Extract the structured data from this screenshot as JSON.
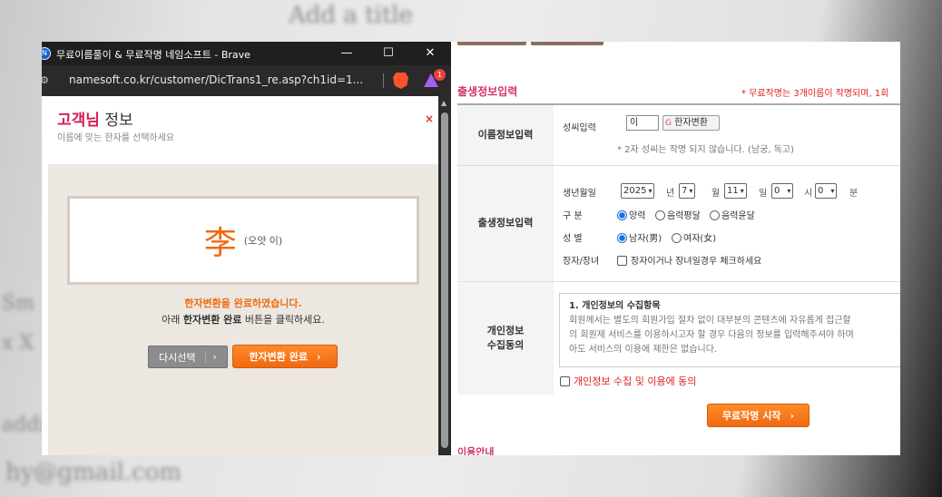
{
  "background": {
    "text_top": "Add a title",
    "text_left_1": "Sm",
    "text_left_2": "x X",
    "text_left_3": "addi",
    "text_bottom": "hy@gmail.com"
  },
  "popup": {
    "app_icon": "N",
    "window_title": "무료이름풀이 & 무료작명 네임소프트 - Brave",
    "controls": {
      "minimize": "—",
      "maximize": "☐",
      "close": "✕"
    },
    "url": "namesoft.co.kr/customer/DicTrans1_re.asp?ch1id=1...",
    "badge_count": "1",
    "title_accent": "고객님",
    "title_rest": " 정보",
    "subtitle": "이름에 맞는 한자를 선택하세요",
    "close_label": "×",
    "hanja": "李",
    "hanja_desc": "(오얏 이)",
    "done_message": "한자변환을 완료하였습니다.",
    "guide_prefix": "아래 ",
    "guide_bold": "한자변환 완료",
    "guide_suffix": " 버튼을 클릭하세요.",
    "reselect_label": "다시선택",
    "complete_label": "한자변환 완료",
    "chevron": "›"
  },
  "main": {
    "section_title": "출생정보입력",
    "section_note": "* 무료작명는 3개이름이 작명되며, 1회",
    "rows": {
      "name": {
        "head": "이름정보입력",
        "surname_label": "성씨입력",
        "surname_value": "이",
        "hanja_button": "한자변환",
        "hanja_button_icon": "G",
        "note": "* 2자 성씨는 작명 되지 않습니다. (남궁, 독고)"
      },
      "birth": {
        "head": "출생정보입력",
        "date_label": "생년월일",
        "year": "2025",
        "year_unit": "년",
        "month": "7",
        "month_unit": "월",
        "day": "11",
        "day_unit": "일",
        "hour": "0",
        "hour_unit": "시",
        "minute": "0",
        "minute_unit": "분",
        "calendar_label": "구 분",
        "calendar_options": [
          "양력",
          "음력평달",
          "음력윤달"
        ],
        "gender_label": "성 별",
        "gender_options": [
          "남자(男)",
          "여자(女)"
        ],
        "eldest_label": "장자/장녀",
        "eldest_check": "장자이거나 장녀일경우 체크하세요"
      },
      "privacy": {
        "head_1": "개인정보",
        "head_2": "수집동의",
        "box_title": "1. 개인정보의 수집항목",
        "box_line_1": "회원께서는 별도의 회원가입 절차 없이 대부분의 콘텐츠에 자유롭게 접근할",
        "box_line_2": "의 회원제 서비스를 이용하시고자 할 경우 다음의 정보를 입력해주셔야 하며",
        "box_line_3": "아도 서비스의 이용에 제한은 없습니다.",
        "agree_label": "개인정보 수집 및 이용에 동의"
      }
    },
    "start_button": "무료작명 시작",
    "bottom_title": "이용안내",
    "arrow": "›"
  }
}
